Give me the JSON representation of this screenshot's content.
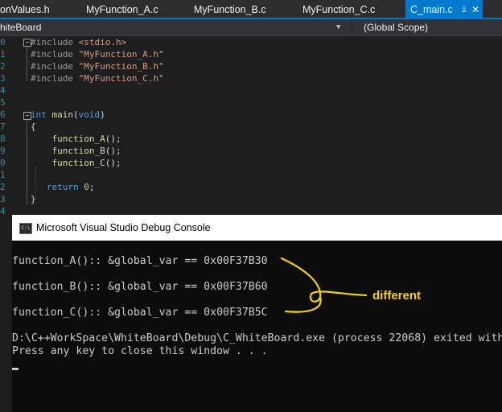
{
  "tabs": [
    {
      "label": "onValues.h",
      "active": false
    },
    {
      "label": "MyFunction_A.c",
      "active": false
    },
    {
      "label": "MyFunction_B.c",
      "active": false
    },
    {
      "label": "MyFunction_C.c",
      "active": false
    },
    {
      "label": "C_main.c",
      "active": true
    }
  ],
  "tab_pin_icon": "pin-icon",
  "tab_close_icon": "close-icon",
  "navbar": {
    "project": "hiteBoard",
    "scope": "(Global Scope)"
  },
  "editor": {
    "line_numbers": [
      "0",
      "1",
      "2",
      "3",
      "4",
      "5",
      "6",
      "7",
      "8",
      "9",
      "0",
      "1",
      "2",
      "3",
      "4"
    ],
    "lines": [
      {
        "parts": [
          [
            "pp",
            "#include "
          ],
          [
            "str",
            "<stdio.h>"
          ]
        ]
      },
      {
        "parts": [
          [
            "pp",
            "#include "
          ],
          [
            "str",
            "\"MyFunction_A.h\""
          ]
        ]
      },
      {
        "parts": [
          [
            "pp",
            "#include "
          ],
          [
            "str",
            "\"MyFunction_B.h\""
          ]
        ]
      },
      {
        "parts": [
          [
            "pp",
            "#include "
          ],
          [
            "str",
            "\"MyFunction_C.h\""
          ]
        ]
      },
      {
        "parts": []
      },
      {
        "parts": []
      },
      {
        "parts": [
          [
            "kw",
            "int "
          ],
          [
            "fn",
            "main"
          ],
          [
            "punc",
            "("
          ],
          [
            "kw",
            "void"
          ],
          [
            "punc",
            ")"
          ]
        ]
      },
      {
        "parts": [
          [
            "punc",
            "{"
          ]
        ]
      },
      {
        "parts": [
          [
            "fn",
            "    function_A"
          ],
          [
            "punc",
            "();"
          ]
        ]
      },
      {
        "parts": [
          [
            "fn",
            "    function_B"
          ],
          [
            "punc",
            "();"
          ]
        ]
      },
      {
        "parts": [
          [
            "fn",
            "    function_C"
          ],
          [
            "punc",
            "();"
          ]
        ]
      },
      {
        "parts": []
      },
      {
        "parts": [
          [
            "kw",
            "   return "
          ],
          [
            "num",
            "0"
          ],
          [
            "punc",
            ";"
          ]
        ]
      },
      {
        "parts": [
          [
            "punc",
            "}"
          ]
        ]
      }
    ]
  },
  "console": {
    "title": "Microsoft Visual Studio Debug Console",
    "icon": "console-app-icon",
    "icon_text": "C:\\",
    "lines": [
      "function_A():: &global_var == 0x00F37B30",
      "function_B():: &global_var == 0x00F37B60",
      "function_C():: &global_var == 0x00F37B5C",
      "D:\\C++WorkSpace\\WhiteBoard\\Debug\\C_WhiteBoard.exe (process 22068) exited with",
      "Press any key to close this window . . ."
    ],
    "annotation": {
      "label": "different",
      "color": "#f4d100"
    }
  },
  "colors": {
    "accent": "#007acc",
    "editor_bg": "#1e1e1e",
    "console_bg": "#0c0c0c",
    "string": "#d69d85",
    "keyword": "#569cd6",
    "function": "#dcdcaa"
  }
}
